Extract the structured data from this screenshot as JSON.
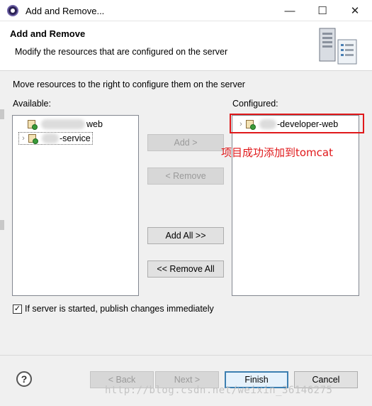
{
  "window": {
    "title": "Add and Remove...",
    "minimize_glyph": "—",
    "maximize_glyph": "☐",
    "close_glyph": "✕"
  },
  "header": {
    "title": "Add and Remove",
    "description": "Modify the resources that are configured on the server"
  },
  "instructions": "Move resources to the right to configure them on the server",
  "available": {
    "label": "Available:",
    "items": [
      {
        "label": "web",
        "expandable": false,
        "icon": "web-project-icon"
      },
      {
        "label": "-service",
        "expandable": true,
        "icon": "web-project-icon"
      }
    ]
  },
  "configured": {
    "label": "Configured:",
    "items": [
      {
        "label": "-developer-web",
        "expandable": true,
        "icon": "web-project-icon"
      }
    ]
  },
  "buttons": {
    "add": "Add >",
    "remove": "< Remove",
    "add_all": "Add All >>",
    "remove_all": "<< Remove All",
    "back": "< Back",
    "next": "Next >",
    "finish": "Finish",
    "cancel": "Cancel"
  },
  "annotation_text": "项目成功添加到tomcat",
  "publish_checkbox": {
    "label": "If server is started, publish changes immediately",
    "checked": true
  },
  "help_glyph": "?",
  "watermark": "http://blog.csdn.net/weixin_36146275",
  "colors": {
    "annotation": "#e0191b",
    "default_button_border": "#3c7fb1"
  }
}
